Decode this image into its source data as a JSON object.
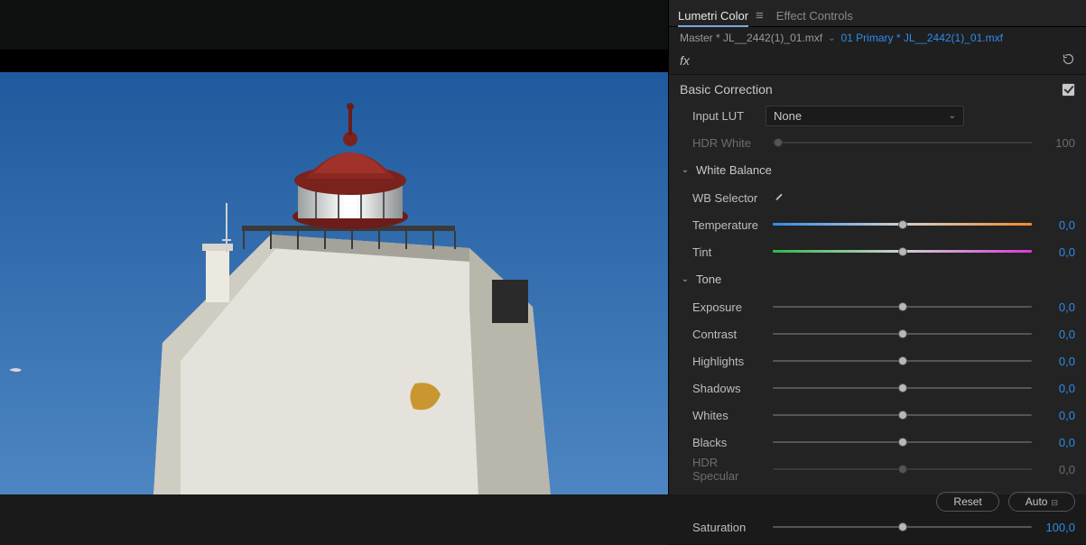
{
  "tabs": {
    "lumetri": "Lumetri Color",
    "effect": "Effect Controls"
  },
  "breadcrumb": {
    "master": "Master * JL__2442(1)_01.mxf",
    "clip": "01 Primary * JL__2442(1)_01.mxf"
  },
  "fx": "fx",
  "section": {
    "basic": "Basic Correction",
    "inputLUT": {
      "label": "Input LUT",
      "value": "None"
    },
    "hdrWhite": {
      "label": "HDR White",
      "value": "100"
    },
    "whiteBalance": {
      "title": "White Balance",
      "wbSelector": "WB Selector",
      "temperature": {
        "label": "Temperature",
        "value": "0,0"
      },
      "tint": {
        "label": "Tint",
        "value": "0,0"
      }
    },
    "tone": {
      "title": "Tone",
      "exposure": {
        "label": "Exposure",
        "value": "0,0"
      },
      "contrast": {
        "label": "Contrast",
        "value": "0,0"
      },
      "highlights": {
        "label": "Highlights",
        "value": "0,0"
      },
      "shadows": {
        "label": "Shadows",
        "value": "0,0"
      },
      "whites": {
        "label": "Whites",
        "value": "0,0"
      },
      "blacks": {
        "label": "Blacks",
        "value": "0,0"
      },
      "hdrSpecular": {
        "label": "HDR Specular",
        "value": "0,0"
      },
      "reset": "Reset",
      "auto": "Auto",
      "saturation": {
        "label": "Saturation",
        "value": "100,0"
      }
    }
  }
}
